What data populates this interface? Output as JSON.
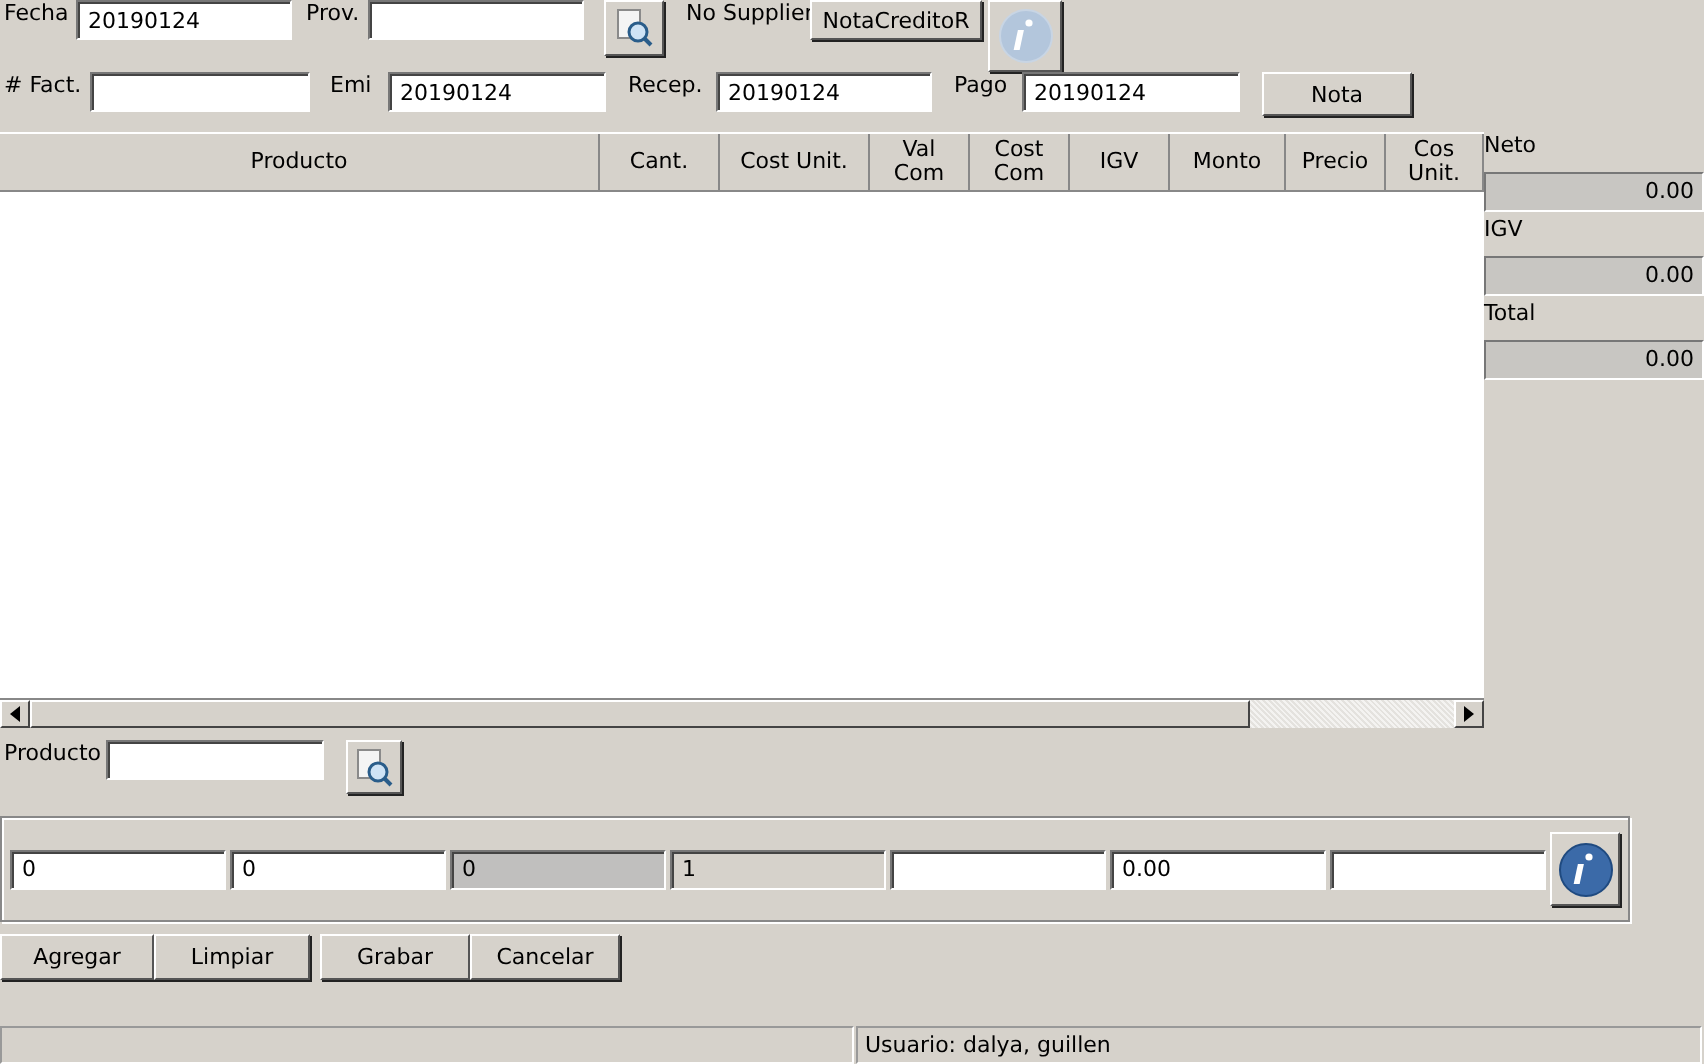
{
  "header_row1": {
    "fecha_label": "Fecha",
    "fecha": "20190124",
    "prov_label": "Prov.",
    "supplier_label": "No Supplier",
    "nota_credito_button": "NotaCreditoR"
  },
  "header_row2": {
    "fact_label": "# Fact.",
    "emi_label": "Emi",
    "emi": "20190124",
    "recep_label": "Recep.",
    "recep": "20190124",
    "pago_label": "Pago",
    "pago": "20190124",
    "nota_button": "Nota"
  },
  "table": {
    "columns": [
      {
        "label": "Producto"
      },
      {
        "label": "Cant."
      },
      {
        "label": "Cost Unit."
      },
      {
        "label": "Val Com"
      },
      {
        "label": "Cost Com"
      },
      {
        "label": "IGV"
      },
      {
        "label": "Monto"
      },
      {
        "label": "Precio"
      },
      {
        "label": "Cos Unit."
      }
    ]
  },
  "totals": [
    {
      "label": "Neto",
      "value": "0.00"
    },
    {
      "label": "IGV",
      "value": "0.00"
    },
    {
      "label": "Total",
      "value": "0.00"
    }
  ],
  "producto_search": {
    "label": "Producto"
  },
  "entry_fields": [
    {
      "kind": "input",
      "value": "0"
    },
    {
      "kind": "input",
      "value": "0"
    },
    {
      "kind": "disabled",
      "value": "0"
    },
    {
      "kind": "readonly",
      "value": "1"
    },
    {
      "kind": "input"
    },
    {
      "kind": "input",
      "value": "0.00"
    },
    {
      "kind": "input"
    }
  ],
  "buttons": [
    {
      "label": "Agregar"
    },
    {
      "label": "Limpiar"
    },
    {
      "label": "Grabar"
    },
    {
      "label": "Cancelar"
    }
  ],
  "status_bar": {
    "user": "Usuario: dalya, guillen"
  }
}
